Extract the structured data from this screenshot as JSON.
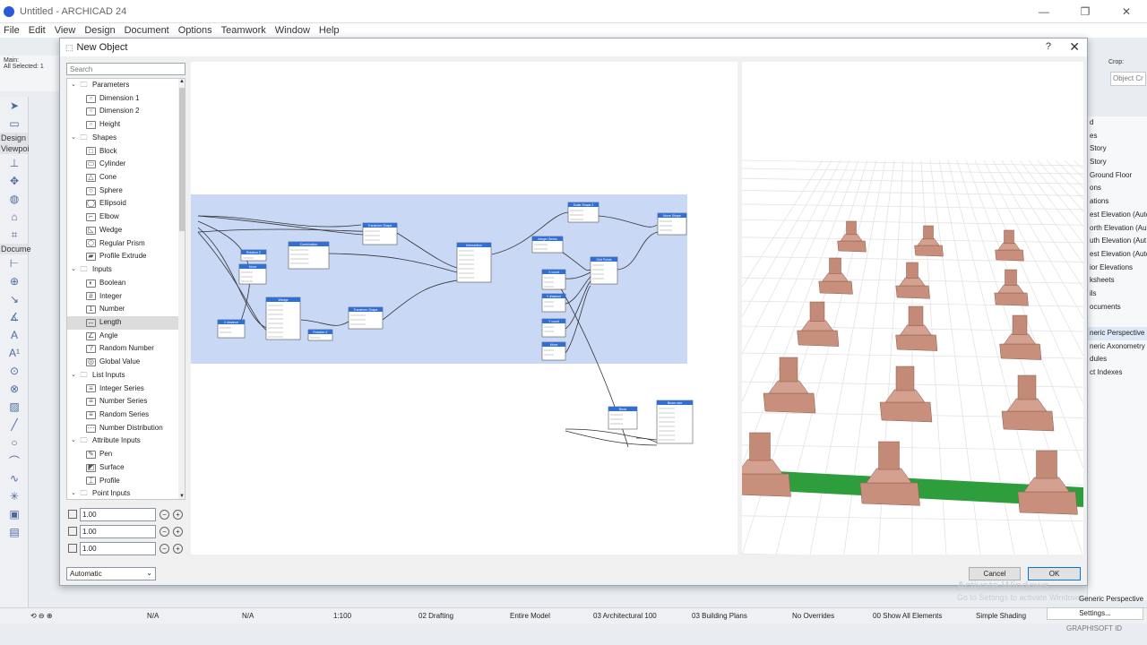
{
  "window": {
    "title": "Untitled - ARCHICAD 24"
  },
  "menu": [
    "File",
    "Edit",
    "View",
    "Design",
    "Document",
    "Options",
    "Teamwork",
    "Window",
    "Help"
  ],
  "info": {
    "main": "Main:",
    "selected": "All Selected: 1"
  },
  "toolbox_labels": {
    "design": "Design",
    "viewpoint": "Viewpoi",
    "document": "Docume"
  },
  "dialog": {
    "title": "New Object",
    "help": "?",
    "search_placeholder": "Search",
    "tree": [
      {
        "type": "group",
        "label": "Parameters"
      },
      {
        "type": "item",
        "label": "Dimension 1",
        "icon": "param-icon"
      },
      {
        "type": "item",
        "label": "Dimension 2",
        "icon": "param-icon"
      },
      {
        "type": "item",
        "label": "Height",
        "icon": "param-icon"
      },
      {
        "type": "group",
        "label": "Shapes"
      },
      {
        "type": "item",
        "label": "Block",
        "icon": "block-icon"
      },
      {
        "type": "item",
        "label": "Cylinder",
        "icon": "cylinder-icon"
      },
      {
        "type": "item",
        "label": "Cone",
        "icon": "cone-icon"
      },
      {
        "type": "item",
        "label": "Sphere",
        "icon": "sphere-icon"
      },
      {
        "type": "item",
        "label": "Ellipsoid",
        "icon": "ellipsoid-icon"
      },
      {
        "type": "item",
        "label": "Elbow",
        "icon": "elbow-icon"
      },
      {
        "type": "item",
        "label": "Wedge",
        "icon": "wedge-icon"
      },
      {
        "type": "item",
        "label": "Regular Prism",
        "icon": "prism-icon"
      },
      {
        "type": "item",
        "label": "Profile Extrude",
        "icon": "extrude-icon"
      },
      {
        "type": "group",
        "label": "Inputs"
      },
      {
        "type": "item",
        "label": "Boolean",
        "icon": "boolean-icon"
      },
      {
        "type": "item",
        "label": "Integer",
        "icon": "integer-icon"
      },
      {
        "type": "item",
        "label": "Number",
        "icon": "number-icon"
      },
      {
        "type": "item",
        "label": "Length",
        "icon": "length-icon",
        "selected": true
      },
      {
        "type": "item",
        "label": "Angle",
        "icon": "angle-icon"
      },
      {
        "type": "item",
        "label": "Random Number",
        "icon": "random-icon"
      },
      {
        "type": "item",
        "label": "Global Value",
        "icon": "global-icon"
      },
      {
        "type": "group",
        "label": "List Inputs"
      },
      {
        "type": "item",
        "label": "Integer Series",
        "icon": "series-icon"
      },
      {
        "type": "item",
        "label": "Number Series",
        "icon": "series-icon"
      },
      {
        "type": "item",
        "label": "Random Series",
        "icon": "series-icon"
      },
      {
        "type": "item",
        "label": "Number Distribution",
        "icon": "distribution-icon"
      },
      {
        "type": "group",
        "label": "Attribute Inputs"
      },
      {
        "type": "item",
        "label": "Pen",
        "icon": "pen-icon"
      },
      {
        "type": "item",
        "label": "Surface",
        "icon": "surface-icon"
      },
      {
        "type": "item",
        "label": "Profile",
        "icon": "profile-icon"
      },
      {
        "type": "group",
        "label": "Point Inputs"
      }
    ],
    "dimensions": [
      "1.00",
      "1.00",
      "1.00"
    ],
    "mode": "Automatic",
    "cancel": "Cancel",
    "ok": "OK",
    "nodes": [
      {
        "title": "Transform Shape"
      },
      {
        "title": "Rotation Z"
      },
      {
        "title": "Move"
      },
      {
        "title": "Combination"
      },
      {
        "title": "Intersection"
      },
      {
        "title": "Scale Shape 2"
      },
      {
        "title": "Integer Series"
      },
      {
        "title": "Grid Points"
      },
      {
        "title": "Move Shape"
      },
      {
        "title": "Wedge"
      },
      {
        "title": "Transform Shape"
      },
      {
        "title": "Rotation Z"
      },
      {
        "title": "X distance"
      },
      {
        "title": "X count"
      },
      {
        "title": "Y distance"
      },
      {
        "title": "Y count"
      },
      {
        "title": "Move"
      },
      {
        "title": "Block"
      },
      {
        "title": "Beam size"
      }
    ]
  },
  "right_panel": {
    "crop": "Crop:",
    "combo": "Object Cr",
    "items": [
      "d",
      "es",
      "Story",
      "Story",
      "Ground Floor",
      "ons",
      "ations",
      "est Elevation (Auto",
      "orth Elevation (Aut",
      "uth Elevation (Aut",
      "est Elevation (Auto",
      "ior Elevations",
      "ksheets",
      "ils",
      "ocuments",
      "",
      "neric Perspective",
      "neric Axonometry",
      "dules",
      "ct Indexes"
    ],
    "perspective": "Generic Perspective",
    "settings": "Settings..."
  },
  "statusbar": {
    "na1": "N/A",
    "na2": "N/A",
    "scale": "1:100",
    "layer": "02 Drafting",
    "model": "Entire Model",
    "pen": "03 Architectural 100",
    "view": "03 Building Plans",
    "override": "No Overrides",
    "renovation": "00 Show All Elements",
    "shading": "Simple Shading"
  },
  "watermark": {
    "line1": "Activate Windows",
    "line2": "Go to Settings to activate Windows."
  },
  "brand": "GRAPHISOFT ID"
}
